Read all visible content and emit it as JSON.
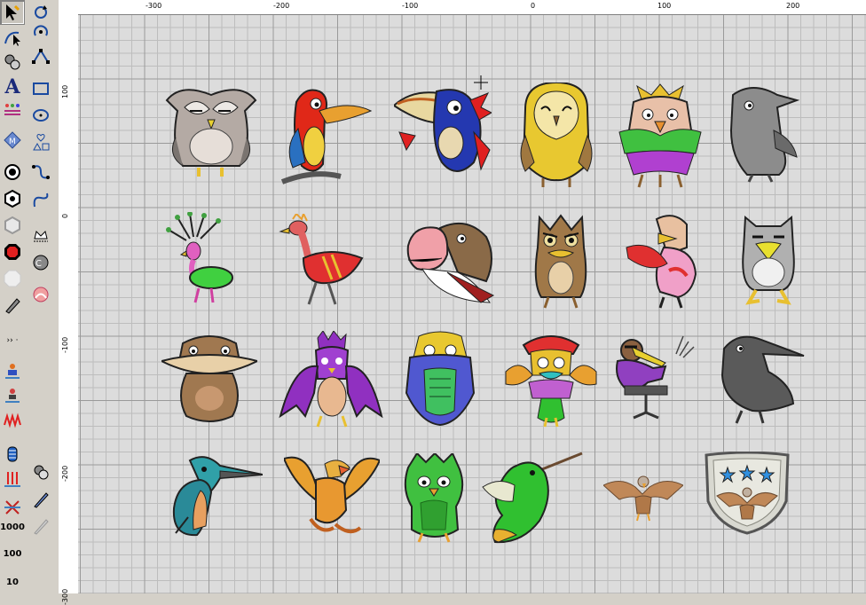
{
  "rulers": {
    "top": [
      "-300",
      "-200",
      "-100",
      "0",
      "100",
      "200"
    ],
    "left": [
      "100",
      "0",
      "-100",
      "-200",
      "-300"
    ]
  },
  "toolbar": {
    "num_1000": "1000",
    "num_100": "100",
    "num_10": "10",
    "text_tool": "A"
  },
  "designs": [
    "owl-grey",
    "parrot-red",
    "toucan-blue",
    "barn-owl-yellow",
    "owl-feathered-colorful",
    "crow-grey-small",
    "peacock-green",
    "flamingo-red",
    "vulture-brown",
    "owl-brown-angry",
    "bird-pink-arms",
    "seagull-grey",
    "kiwi-brown",
    "phoenix-purple",
    "owl-blue-green",
    "bird-red-crest",
    "bird-smoking-chair",
    "crow-black",
    "kingfisher",
    "eagle-orange",
    "owl-green-fluffy",
    "hummingbird-green",
    "eagle-small-brown",
    "shield-eagle-stars"
  ],
  "colors": {
    "canvas": "#dcdcdc",
    "grid_major": "#9a9a9a",
    "grid_minor": "#bdbdbd",
    "toolbar": "#d4d0c8"
  }
}
